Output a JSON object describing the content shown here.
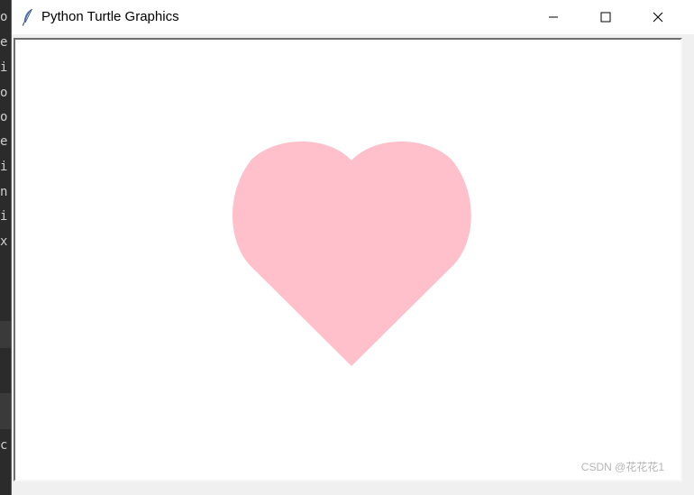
{
  "window": {
    "title": "Python Turtle Graphics",
    "icon": "feather-icon",
    "controls": {
      "minimize": "minimize-icon",
      "maximize": "maximize-icon",
      "close": "close-icon"
    }
  },
  "background_terminal": {
    "chars": [
      "o",
      "e",
      "i",
      "o",
      "o",
      "e",
      "i",
      "n",
      "i",
      "x",
      "c"
    ]
  },
  "canvas": {
    "shape": "heart",
    "fill_color": "#ffc0cb",
    "background_color": "#ffffff"
  },
  "watermark": "CSDN @花花花1"
}
